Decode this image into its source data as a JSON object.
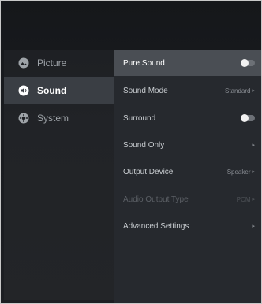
{
  "nav": {
    "items": [
      {
        "label": "Picture",
        "icon": "picture-icon",
        "active": false
      },
      {
        "label": "Sound",
        "icon": "speaker-icon",
        "active": true
      },
      {
        "label": "System",
        "icon": "system-icon",
        "active": false
      }
    ]
  },
  "settings": {
    "rows": [
      {
        "label": "Pure Sound",
        "control": "toggle",
        "state": "off"
      },
      {
        "label": "Sound Mode",
        "value": "Standard"
      },
      {
        "label": "Surround",
        "control": "toggle",
        "state": "off"
      },
      {
        "label": "Sound Only"
      },
      {
        "label": "Output Device",
        "value": "Speaker"
      },
      {
        "label": "Audio Output Type",
        "value": "PCM",
        "disabled": true
      },
      {
        "label": "Advanced Settings"
      }
    ]
  },
  "colors": {
    "background": "#1a1c20",
    "panel": "#26292e",
    "highlight": "#4a4e54",
    "active_nav": "#3a3e44"
  }
}
